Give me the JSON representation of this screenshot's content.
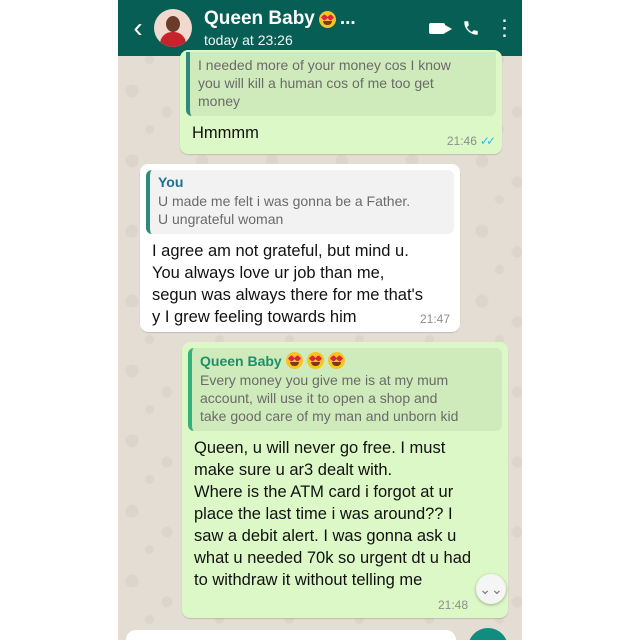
{
  "header": {
    "back_icon": "chevron-left-icon",
    "contact_name": "Queen Baby",
    "name_suffix": "...",
    "status": "today at 23:26",
    "icons": [
      "video-call-icon",
      "phone-icon",
      "more-options-icon"
    ],
    "more_label": "⋮",
    "color": "#075e54"
  },
  "messages": [
    {
      "direction": "outgoing",
      "quote_text": "I needed more of your money cos I know\nyou will kill a human cos of me too get\nmoney",
      "text": "Hmmmm",
      "time": "21:46",
      "read": true
    },
    {
      "direction": "incoming",
      "quote_author": "You",
      "quote_text": "U made me felt i was gonna be a Father.\nU ungrateful woman",
      "text": "I agree am not grateful, but mind u.\nYou always love ur job than me,\nsegun was always there for me that's\ny I grew feeling towards him",
      "time": "21:47"
    },
    {
      "direction": "outgoing",
      "quote_author": "Queen Baby",
      "quote_text": "Every money you give me is at my mum\naccount, will use it to open a shop and\ntake good care of my man and unborn kid",
      "text": "Queen, u will never go free. I must\nmake sure u ar3 dealt with.\nWhere is the ATM card i forgot at ur\nplace the last time i was around?? I\nsaw a debit alert. I was gonna ask u\nwhat u needed 70k so urgent dt u had\nto withdraw it without telling me",
      "time": "21:48"
    }
  ],
  "colors": {
    "outgoing_bubble": "#dcf8c6",
    "incoming_bubble": "#ffffff",
    "chat_background": "#e3ddd4",
    "read_ticks": "#34b7f1"
  },
  "scroll_icon": "double-chevron-down-icon",
  "scroll_label": "⌄⌄"
}
